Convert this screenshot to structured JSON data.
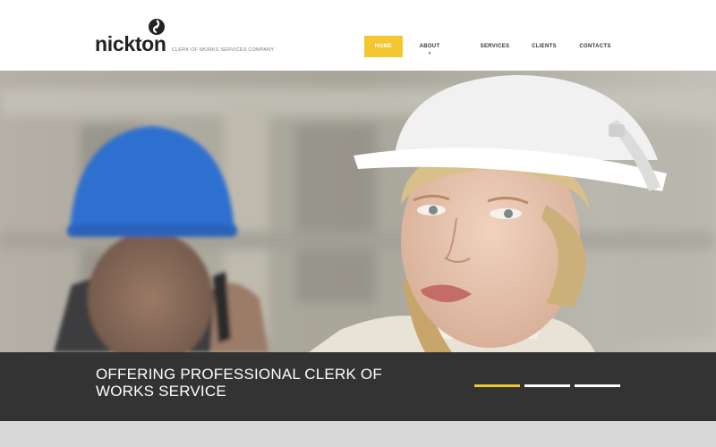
{
  "logo": {
    "name": "nickton",
    "tagline": "CLERK OF WORKS SERVICES COMPANY"
  },
  "nav": {
    "items": [
      {
        "label": "HOME",
        "active": true
      },
      {
        "label": "ABOUT",
        "has_submenu": true
      },
      {
        "label": "SERVICES"
      },
      {
        "label": "CLIENTS"
      },
      {
        "label": "CONTACTS"
      }
    ]
  },
  "hero": {
    "caption": "OFFERING  PROFESSIONAL CLERK OF WORKS SERVICE",
    "slides": 3,
    "active_slide": 1
  },
  "colors": {
    "accent": "#f2c72f",
    "caption_bg": "#333333",
    "header_bg": "#ffffff"
  }
}
